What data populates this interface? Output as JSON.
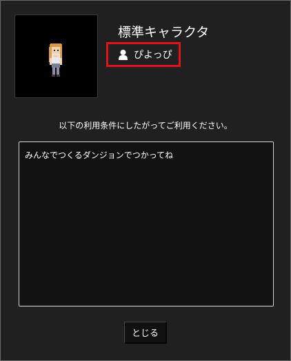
{
  "character": {
    "name": "標準キャラクタ",
    "sprite_icon": "character-sprite"
  },
  "author": {
    "icon": "user-icon",
    "name": "ぴよっぴ"
  },
  "terms": {
    "caption": "以下の利用条件にしたがってご利用ください。",
    "text": "みんなでつくるダンジョンでつかってね"
  },
  "actions": {
    "close_label": "とじる"
  },
  "colors": {
    "background": "#202020",
    "highlight": "#e2121a",
    "terms_background": "#121212"
  }
}
